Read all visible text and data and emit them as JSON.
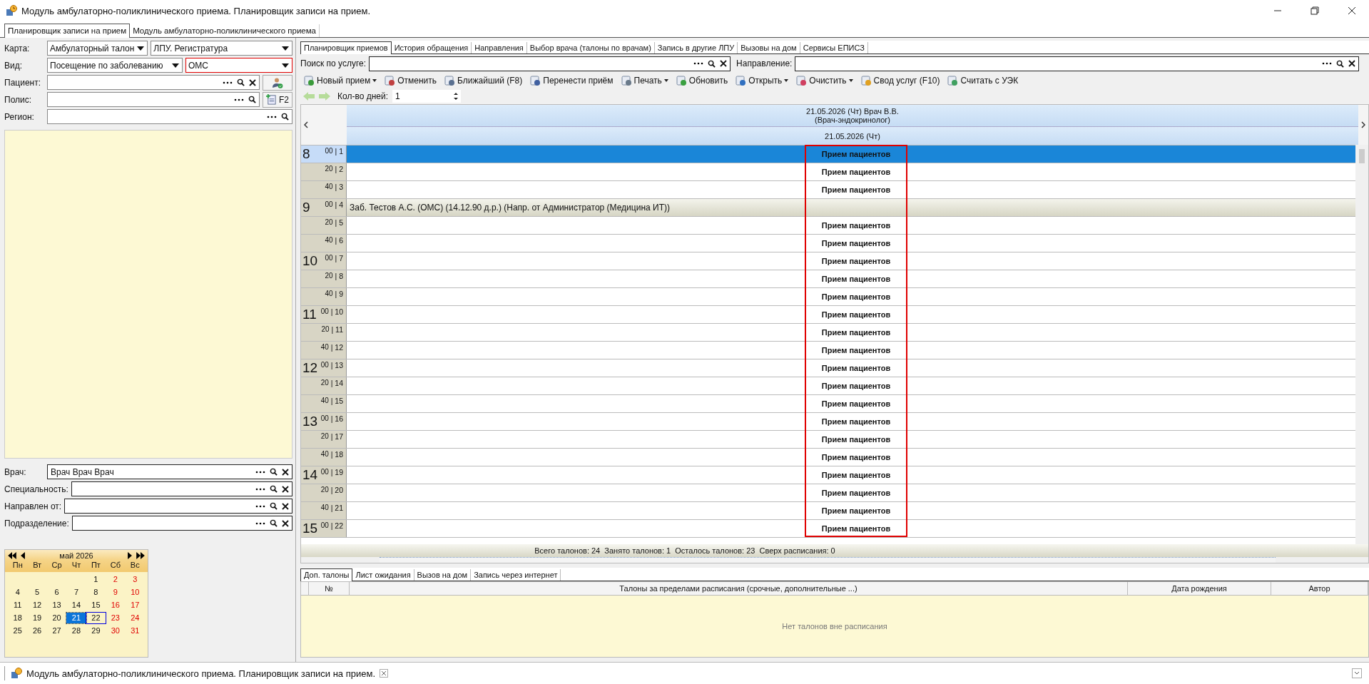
{
  "window": {
    "title": "Модуль амбулаторно-поликлинического приема. Планировщик записи на прием."
  },
  "outer_tabs": [
    {
      "label": "Планировщик записи на прием",
      "selected": true
    },
    {
      "label": "Модуль амбулаторно-поликлинического приема",
      "selected": false
    }
  ],
  "form_rows": [
    {
      "label": "Карта:",
      "controls": [
        {
          "kind": "dropdown",
          "value": "Амбулаторный талон",
          "error": false
        },
        {
          "kind": "dropdown",
          "value": "ЛПУ. Регистратура",
          "error": false
        }
      ]
    },
    {
      "label": "Вид:",
      "controls": [
        {
          "kind": "dropdown",
          "value": "Посещение по заболеванию",
          "error": false
        },
        {
          "kind": "dropdown",
          "value": "ОМС",
          "error": true
        }
      ]
    },
    {
      "label": "Пациент:",
      "controls": [
        {
          "kind": "lookup",
          "clear": true
        },
        {
          "kind": "icon-button"
        }
      ]
    },
    {
      "label": "Полис:",
      "controls": [
        {
          "kind": "lookup",
          "clear": false
        },
        {
          "kind": "button",
          "label": "F2"
        }
      ]
    },
    {
      "label": "Регион:",
      "controls": [
        {
          "kind": "lookup",
          "clear": false
        }
      ]
    }
  ],
  "doctor_fields": [
    {
      "label": "Врач:",
      "value": "Врач Врач Врач"
    },
    {
      "label": "Специальность:"
    },
    {
      "label": "Направлен от:"
    },
    {
      "label": "Подразделение:"
    }
  ],
  "calendar": {
    "month": "май 2026",
    "weekdays": [
      {
        "label": "Пн"
      },
      {
        "label": "Вт"
      },
      {
        "label": "Ср"
      },
      {
        "label": "Чт"
      },
      {
        "label": "Пт"
      },
      {
        "label": "Сб"
      },
      {
        "label": "Вс"
      }
    ],
    "weeks": [
      [
        {
          "kind": "blank"
        },
        {
          "kind": "blank"
        },
        {
          "kind": "blank"
        },
        {
          "kind": "blank"
        },
        {
          "day": "1",
          "weekend": false,
          "selected": false,
          "today": false
        },
        {
          "day": "2",
          "weekend": true,
          "selected": false,
          "today": false
        },
        {
          "day": "3",
          "weekend": true,
          "selected": false,
          "today": false
        }
      ],
      [
        {
          "day": "4",
          "weekend": false,
          "selected": false,
          "today": false
        },
        {
          "day": "5",
          "weekend": false,
          "selected": false,
          "today": false
        },
        {
          "day": "6",
          "weekend": false,
          "selected": false,
          "today": false
        },
        {
          "day": "7",
          "weekend": false,
          "selected": false,
          "today": false
        },
        {
          "day": "8",
          "weekend": false,
          "selected": false,
          "today": false
        },
        {
          "day": "9",
          "weekend": true,
          "selected": false,
          "today": false
        },
        {
          "day": "10",
          "weekend": true,
          "selected": false,
          "today": false
        }
      ],
      [
        {
          "day": "11",
          "weekend": false,
          "selected": false,
          "today": false
        },
        {
          "day": "12",
          "weekend": false,
          "selected": false,
          "today": false
        },
        {
          "day": "13",
          "weekend": false,
          "selected": false,
          "today": false
        },
        {
          "day": "14",
          "weekend": false,
          "selected": false,
          "today": false
        },
        {
          "day": "15",
          "weekend": false,
          "selected": false,
          "today": false
        },
        {
          "day": "16",
          "weekend": true,
          "selected": false,
          "today": false
        },
        {
          "day": "17",
          "weekend": true,
          "selected": false,
          "today": false
        }
      ],
      [
        {
          "day": "18",
          "weekend": false,
          "selected": false,
          "today": false
        },
        {
          "day": "19",
          "weekend": false,
          "selected": false,
          "today": false
        },
        {
          "day": "20",
          "weekend": false,
          "selected": false,
          "today": false
        },
        {
          "day": "21",
          "weekend": false,
          "selected": true,
          "today": false
        },
        {
          "day": "22",
          "weekend": false,
          "selected": false,
          "today": true
        },
        {
          "day": "23",
          "weekend": true,
          "selected": false,
          "today": false
        },
        {
          "day": "24",
          "weekend": true,
          "selected": false,
          "today": false
        }
      ],
      [
        {
          "day": "25",
          "weekend": false,
          "selected": false,
          "today": false
        },
        {
          "day": "26",
          "weekend": false,
          "selected": false,
          "today": false
        },
        {
          "day": "27",
          "weekend": false,
          "selected": false,
          "today": false
        },
        {
          "day": "28",
          "weekend": false,
          "selected": false,
          "today": false
        },
        {
          "day": "29",
          "weekend": false,
          "selected": false,
          "today": false
        },
        {
          "day": "30",
          "weekend": true,
          "selected": false,
          "today": false
        },
        {
          "day": "31",
          "weekend": true,
          "selected": false,
          "today": false
        }
      ]
    ]
  },
  "inner_tabs": [
    {
      "label": "Планировщик приемов",
      "selected": true
    },
    {
      "label": "История обращения",
      "selected": false
    },
    {
      "label": "Направления",
      "selected": false
    },
    {
      "label": "Выбор врача (талоны по врачам)",
      "selected": false
    },
    {
      "label": "Запись в другие ЛПУ",
      "selected": false
    },
    {
      "label": "Вызовы на дом",
      "selected": false
    },
    {
      "label": "Сервисы ЕПИСЗ",
      "selected": false
    }
  ],
  "search": {
    "service_label": "Поиск по услуге:",
    "direction_label": "Направление:"
  },
  "toolbar": [
    {
      "label": "Новый прием",
      "dropdown": true
    },
    {
      "label": "Отменить",
      "dropdown": false
    },
    {
      "label": "Ближайший (F8)",
      "dropdown": false
    },
    {
      "label": "Перенести приём",
      "dropdown": false
    },
    {
      "label": "Печать",
      "dropdown": true
    },
    {
      "label": "Обновить",
      "dropdown": false
    },
    {
      "label": "Открыть",
      "dropdown": true
    },
    {
      "label": "Очистить",
      "dropdown": true
    },
    {
      "label": "Свод услуг (F10)",
      "dropdown": false
    },
    {
      "label": "Считать с УЭК",
      "dropdown": false
    }
  ],
  "days": {
    "label": "Кол-во дней:",
    "value": "1"
  },
  "schedule": {
    "doctor_header": [
      "21.05.2026 (Чт) Врач В.В.",
      "(Врач-эндокринолог)"
    ],
    "date_header": "21.05.2026 (Чт)",
    "slots": [
      {
        "hour": "8",
        "minute": "00",
        "separator": "|",
        "number": "1",
        "kind": "free",
        "text": "Прием пациентов",
        "selected": true
      },
      {
        "minute": "20",
        "separator": "|",
        "number": "2",
        "kind": "free",
        "text": "Прием пациентов",
        "selected": false
      },
      {
        "minute": "40",
        "separator": "|",
        "number": "3",
        "kind": "free",
        "text": "Прием пациентов",
        "selected": false
      },
      {
        "hour": "9",
        "minute": "00",
        "separator": "|",
        "number": "4",
        "kind": "booked",
        "text": "Заб. Тестов А.С. (ОМС) (14.12.90 д.р.) (Напр. от Администратор (Медицина ИТ))",
        "selected": false
      },
      {
        "minute": "20",
        "separator": "|",
        "number": "5",
        "kind": "free",
        "text": "Прием пациентов",
        "selected": false
      },
      {
        "minute": "40",
        "separator": "|",
        "number": "6",
        "kind": "free",
        "text": "Прием пациентов",
        "selected": false
      },
      {
        "hour": "10",
        "minute": "00",
        "separator": "|",
        "number": "7",
        "kind": "free",
        "text": "Прием пациентов",
        "selected": false
      },
      {
        "minute": "20",
        "separator": "|",
        "number": "8",
        "kind": "free",
        "text": "Прием пациентов",
        "selected": false
      },
      {
        "minute": "40",
        "separator": "|",
        "number": "9",
        "kind": "free",
        "text": "Прием пациентов",
        "selected": false
      },
      {
        "hour": "11",
        "minute": "00",
        "separator": "|",
        "number": "10",
        "kind": "free",
        "text": "Прием пациентов",
        "selected": false
      },
      {
        "minute": "20",
        "separator": "|",
        "number": "11",
        "kind": "free",
        "text": "Прием пациентов",
        "selected": false
      },
      {
        "minute": "40",
        "separator": "|",
        "number": "12",
        "kind": "free",
        "text": "Прием пациентов",
        "selected": false
      },
      {
        "hour": "12",
        "minute": "00",
        "separator": "|",
        "number": "13",
        "kind": "free",
        "text": "Прием пациентов",
        "selected": false
      },
      {
        "minute": "20",
        "separator": "|",
        "number": "14",
        "kind": "free",
        "text": "Прием пациентов",
        "selected": false
      },
      {
        "minute": "40",
        "separator": "|",
        "number": "15",
        "kind": "free",
        "text": "Прием пациентов",
        "selected": false
      },
      {
        "hour": "13",
        "minute": "00",
        "separator": "|",
        "number": "16",
        "kind": "free",
        "text": "Прием пациентов",
        "selected": false
      },
      {
        "minute": "20",
        "separator": "|",
        "number": "17",
        "kind": "free",
        "text": "Прием пациентов",
        "selected": false
      },
      {
        "minute": "40",
        "separator": "|",
        "number": "18",
        "kind": "free",
        "text": "Прием пациентов",
        "selected": false
      },
      {
        "hour": "14",
        "minute": "00",
        "separator": "|",
        "number": "19",
        "kind": "free",
        "text": "Прием пациентов",
        "selected": false
      },
      {
        "minute": "20",
        "separator": "|",
        "number": "20",
        "kind": "free",
        "text": "Прием пациентов",
        "selected": false
      },
      {
        "minute": "40",
        "separator": "|",
        "number": "21",
        "kind": "free",
        "text": "Прием пациентов",
        "selected": false
      },
      {
        "hour": "15",
        "minute": "00",
        "separator": "|",
        "number": "22",
        "kind": "free",
        "text": "Прием пациентов",
        "selected": false
      }
    ],
    "summary": "Всего талонов: 24  Занято талонов: 1  Осталось талонов: 23  Сверх расписания: 0"
  },
  "bottom_tabs": [
    {
      "label": "Доп. талоны",
      "selected": true
    },
    {
      "label": "Лист ожидания",
      "selected": false
    },
    {
      "label": "Вызов на дом",
      "selected": false
    },
    {
      "label": "Запись через интернет",
      "selected": false
    }
  ],
  "extra_table": {
    "columns": [
      "№",
      "Талоны за пределами расписания (срочные, дополнительные ...)",
      "Дата рождения",
      "Автор"
    ],
    "empty_message": "Нет талонов вне расписания"
  },
  "taskbar": {
    "label": "Модуль амбулаторно-поликлинического приема. Планировщик записи на прием."
  }
}
